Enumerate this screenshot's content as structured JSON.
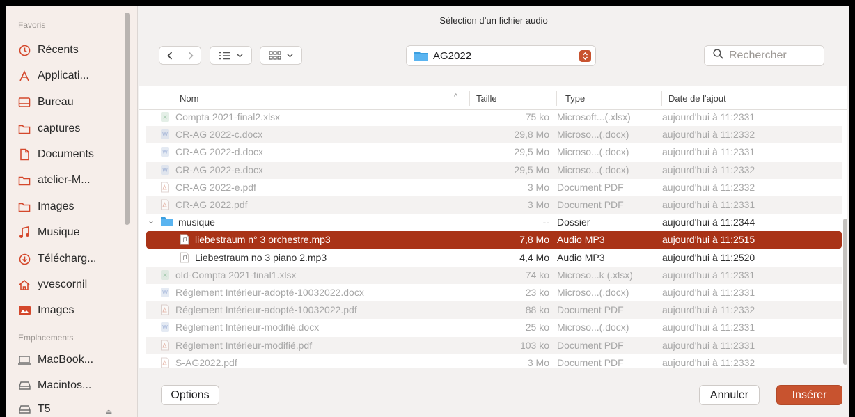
{
  "sidebar": {
    "favorites_header": "Favoris",
    "locations_header": "Emplacements",
    "favorites": [
      {
        "label": "Récents",
        "icon": "clock-icon"
      },
      {
        "label": "Applicati...",
        "icon": "applications-icon"
      },
      {
        "label": "Bureau",
        "icon": "desktop-icon"
      },
      {
        "label": "captures",
        "icon": "folder-icon"
      },
      {
        "label": "Documents",
        "icon": "document-icon"
      },
      {
        "label": "atelier-M...",
        "icon": "folder-icon"
      },
      {
        "label": "Images",
        "icon": "folder-icon"
      },
      {
        "label": "Musique",
        "icon": "music-note-icon"
      },
      {
        "label": "Télécharg...",
        "icon": "download-icon"
      },
      {
        "label": "yvescornil",
        "icon": "home-icon"
      },
      {
        "label": "Images",
        "icon": "photos-icon"
      }
    ],
    "locations": [
      {
        "label": "MacBook...",
        "icon": "laptop-icon"
      },
      {
        "label": "Macintos...",
        "icon": "disk-icon"
      },
      {
        "label": "T5",
        "icon": "disk-icon"
      }
    ]
  },
  "dialog": {
    "title": "Sélection d’un fichier audio",
    "path": "AG2022",
    "search_placeholder": "Rechercher",
    "options_label": "Options",
    "cancel_label": "Annuler",
    "insert_label": "Insérer"
  },
  "columns": {
    "name": "Nom",
    "size": "Taille",
    "type": "Type",
    "date": "Date de l'ajout"
  },
  "rows": [
    {
      "name": "Compta 2021-final2.xlsx",
      "size": "75 ko",
      "type": "Microsoft...(.xlsx)",
      "date": "aujourd'hui à 11:2331",
      "icon": "excel-file-icon",
      "state": "dim"
    },
    {
      "name": "CR-AG 2022-c.docx",
      "size": "29,8 Mo",
      "type": "Microso...(.docx)",
      "date": "aujourd'hui à 11:2332",
      "icon": "word-file-icon",
      "state": "dim"
    },
    {
      "name": "CR-AG 2022-d.docx",
      "size": "29,5 Mo",
      "type": "Microso...(.docx)",
      "date": "aujourd'hui à 11:2331",
      "icon": "word-file-icon",
      "state": "dim"
    },
    {
      "name": "CR-AG 2022-e.docx",
      "size": "29,5 Mo",
      "type": "Microso...(.docx)",
      "date": "aujourd'hui à 11:2332",
      "icon": "word-file-icon",
      "state": "dim"
    },
    {
      "name": "CR-AG 2022-e.pdf",
      "size": "3 Mo",
      "type": "Document PDF",
      "date": "aujourd'hui à 11:2332",
      "icon": "pdf-file-icon",
      "state": "dim"
    },
    {
      "name": "CR-AG 2022.pdf",
      "size": "3 Mo",
      "type": "Document PDF",
      "date": "aujourd'hui à 11:2331",
      "icon": "pdf-file-icon",
      "state": "dim"
    },
    {
      "name": "musique",
      "size": "--",
      "type": "Dossier",
      "date": "aujourd'hui à 11:2344",
      "icon": "folder-icon",
      "state": "folder"
    },
    {
      "name": "liebestraum n° 3 orchestre.mp3",
      "size": "7,8 Mo",
      "type": "Audio MP3",
      "date": "aujourd'hui à 11:2515",
      "icon": "audio-file-icon",
      "state": "selected"
    },
    {
      "name": "Liebestraum no 3 piano 2.mp3",
      "size": "4,4 Mo",
      "type": "Audio MP3",
      "date": "aujourd'hui à 11:2520",
      "icon": "audio-file-icon",
      "state": "normal"
    },
    {
      "name": "old-Compta 2021-final1.xlsx",
      "size": "74 ko",
      "type": "Microso...k (.xlsx)",
      "date": "aujourd'hui à 11:2331",
      "icon": "excel-file-icon",
      "state": "dim"
    },
    {
      "name": "Réglement Intérieur-adopté-10032022.docx",
      "size": "23 ko",
      "type": "Microso...(.docx)",
      "date": "aujourd'hui à 11:2331",
      "icon": "word-file-icon",
      "state": "dim"
    },
    {
      "name": "Réglement Intérieur-adopté-10032022.pdf",
      "size": "88 ko",
      "type": "Document PDF",
      "date": "aujourd'hui à 11:2332",
      "icon": "pdf-file-icon",
      "state": "dim"
    },
    {
      "name": "Réglement Intérieur-modifié.docx",
      "size": "25 ko",
      "type": "Microso...(.docx)",
      "date": "aujourd'hui à 11:2331",
      "icon": "word-file-icon",
      "state": "dim"
    },
    {
      "name": "Réglement Intérieur-modifié.pdf",
      "size": "103 ko",
      "type": "Document PDF",
      "date": "aujourd'hui à 11:2331",
      "icon": "pdf-file-icon",
      "state": "dim"
    },
    {
      "name": "S-AG2022.pdf",
      "size": "3 Mo",
      "type": "Document PDF",
      "date": "aujourd'hui à 11:2332",
      "icon": "pdf-file-icon",
      "state": "dim"
    }
  ],
  "colors": {
    "accent": "#c8532f",
    "selection": "#a93317",
    "sidebar_icon": "#d4482c"
  }
}
